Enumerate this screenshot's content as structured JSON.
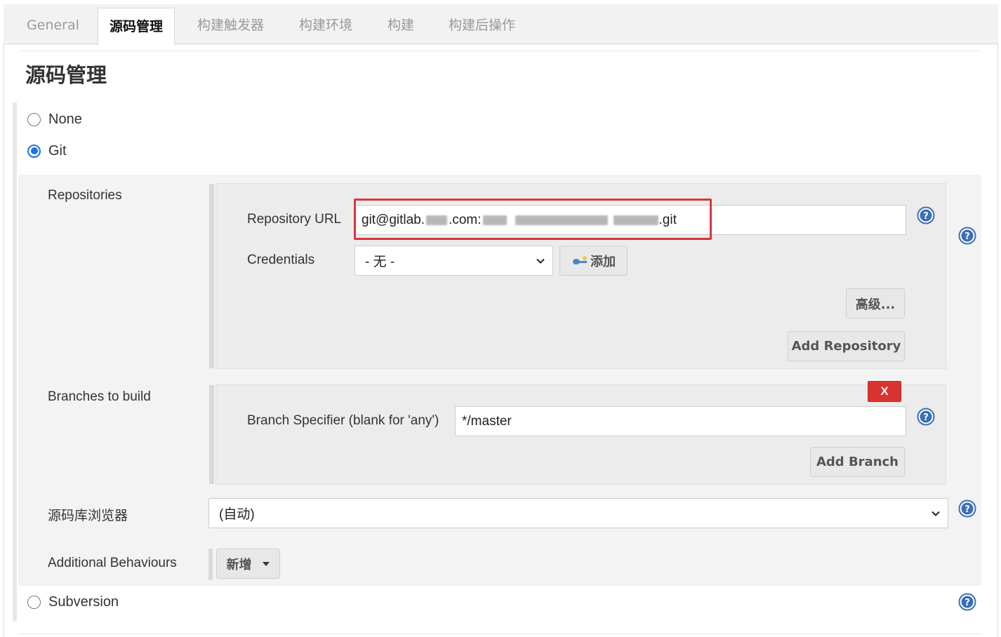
{
  "tabs": [
    {
      "label": "General"
    },
    {
      "label": "源码管理"
    },
    {
      "label": "构建触发器"
    },
    {
      "label": "构建环境"
    },
    {
      "label": "构建"
    },
    {
      "label": "构建后操作"
    }
  ],
  "section": {
    "title": "源码管理"
  },
  "scm": {
    "none_label": "None",
    "git_label": "Git",
    "subversion_label": "Subversion",
    "selected": "Git"
  },
  "repositories": {
    "label": "Repositories",
    "url_label": "Repository URL",
    "url_prefix": "git@gitlab.",
    "url_mid": ".com:",
    "url_suffix": ".git",
    "credentials_label": "Credentials",
    "credentials_value": "- 无 -",
    "add_button": "添加",
    "advanced_button": "高级...",
    "add_repository_button": "Add Repository"
  },
  "branches": {
    "label": "Branches to build",
    "specifier_label": "Branch Specifier (blank for 'any')",
    "specifier_value": "*/master",
    "delete_button": "X",
    "add_branch_button": "Add Branch"
  },
  "browser": {
    "label": "源码库浏览器",
    "value": "(自动)"
  },
  "behaviours": {
    "label": "Additional Behaviours",
    "add_button": "新增"
  },
  "colors": {
    "highlight": "#d9363e",
    "radio_checked": "#1a73e8",
    "delete_button": "#d9332f",
    "help_icon": "#3b6fb6"
  }
}
